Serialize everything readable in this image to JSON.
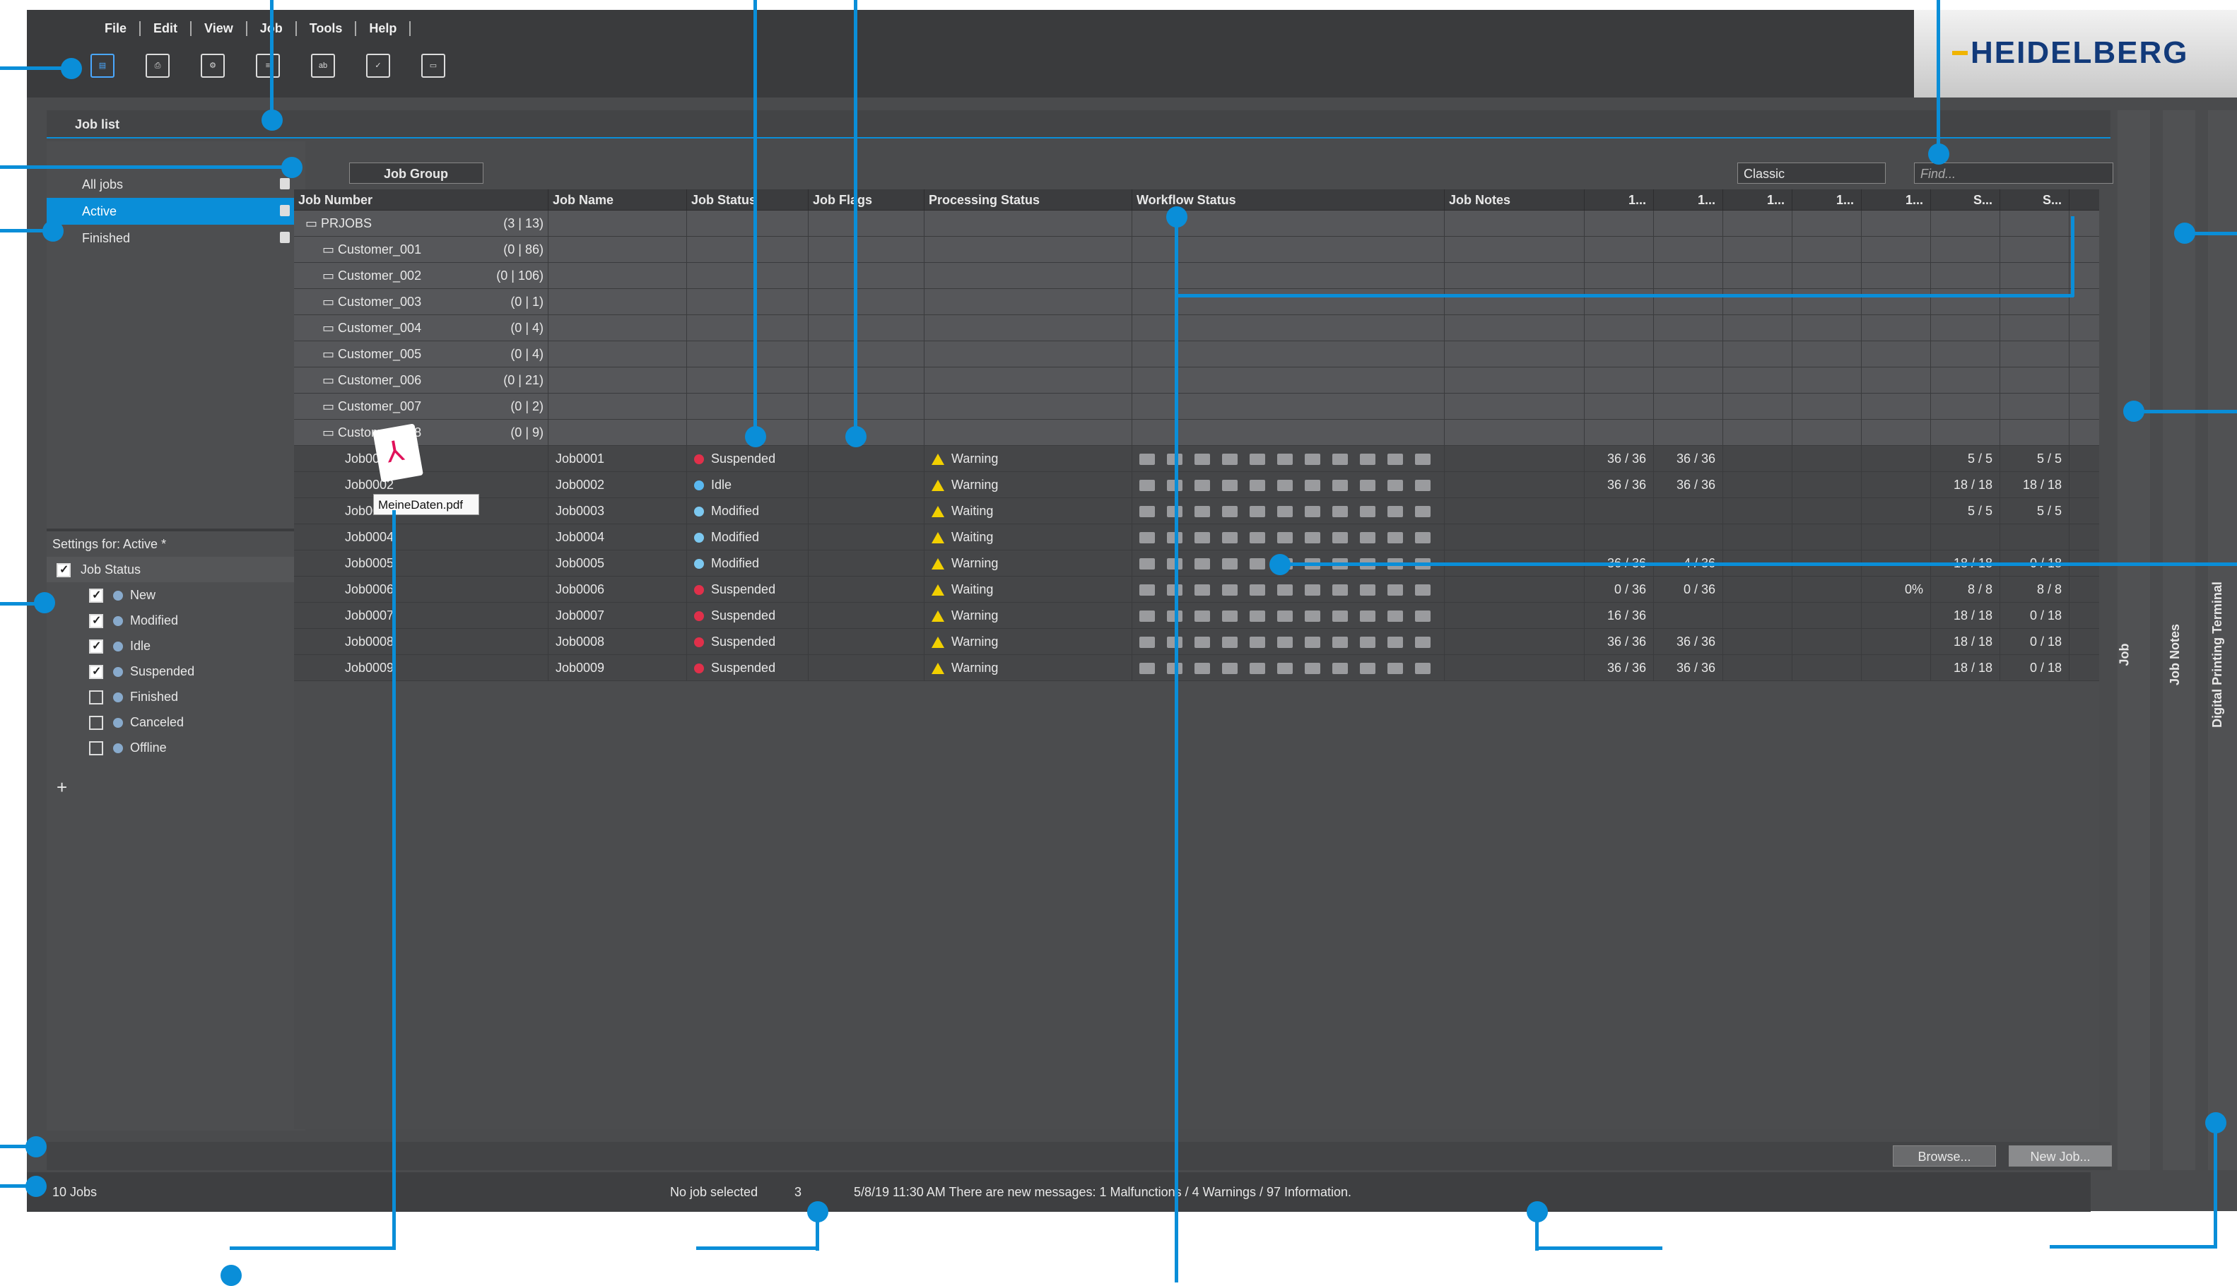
{
  "menu": [
    "File",
    "Edit",
    "View",
    "Job",
    "Tools",
    "Help"
  ],
  "logo": "HEIDELBERG",
  "joblist_title": "Job list",
  "job_group": "Job Group",
  "view_select": "Classic",
  "find_placeholder": "Find...",
  "nav": [
    {
      "label": "All jobs"
    },
    {
      "label": "Active",
      "selected": true
    },
    {
      "label": "Finished"
    }
  ],
  "settings_title": "Settings for: Active *",
  "job_status_title": "Job Status",
  "status_filters": [
    {
      "label": "New",
      "checked": true
    },
    {
      "label": "Modified",
      "checked": true
    },
    {
      "label": "Idle",
      "checked": true
    },
    {
      "label": "Suspended",
      "checked": true
    },
    {
      "label": "Finished",
      "checked": false
    },
    {
      "label": "Canceled",
      "checked": false
    },
    {
      "label": "Offline",
      "checked": false
    }
  ],
  "add": "+",
  "columns": [
    "Job Number",
    "Job Name",
    "Job Status",
    "Job Flags",
    "Processing Status",
    "Workflow Status",
    "Job Notes",
    "1...",
    "1...",
    "1...",
    "1...",
    "1...",
    "S...",
    "S..."
  ],
  "groups": [
    {
      "name": "PRJOBS",
      "count": "(3 | 13)"
    },
    {
      "name": "Customer_001",
      "count": "(0 | 86)"
    },
    {
      "name": "Customer_002",
      "count": "(0 | 106)"
    },
    {
      "name": "Customer_003",
      "count": "(0 | 1)"
    },
    {
      "name": "Customer_004",
      "count": "(0 | 4)"
    },
    {
      "name": "Customer_005",
      "count": "(0 | 4)"
    },
    {
      "name": "Customer_006",
      "count": "(0 | 21)"
    },
    {
      "name": "Customer_007",
      "count": "(0 | 2)"
    },
    {
      "name": "Customer_008",
      "count": "(0 | 9)"
    }
  ],
  "jobs": [
    {
      "num": "Job0001",
      "name": "Job0001",
      "status": "Suspended",
      "color": "#e0304a",
      "proc": "Warning",
      "a": "36 / 36",
      "b": "36 / 36",
      "c": "",
      "d": "5 / 5",
      "e": "5 / 5"
    },
    {
      "num": "Job0002",
      "name": "Job0002",
      "status": "Idle",
      "color": "#5ab8f0",
      "proc": "Warning",
      "a": "36 / 36",
      "b": "36 / 36",
      "c": "",
      "d": "18 / 18",
      "e": "18 / 18"
    },
    {
      "num": "Job0003",
      "name": "Job0003",
      "status": "Modified",
      "color": "#7cc8f0",
      "proc": "Waiting",
      "a": "",
      "b": "",
      "c": "",
      "d": "5 / 5",
      "e": "5 / 5"
    },
    {
      "num": "Job0004",
      "name": "Job0004",
      "status": "Modified",
      "color": "#7cc8f0",
      "proc": "Waiting",
      "a": "",
      "b": "",
      "c": "",
      "d": "",
      "e": ""
    },
    {
      "num": "Job0005",
      "name": "Job0005",
      "status": "Modified",
      "color": "#7cc8f0",
      "proc": "Warning",
      "a": "36 / 36",
      "b": "4 / 36",
      "c": "",
      "d": "18 / 18",
      "e": "0 / 18"
    },
    {
      "num": "Job0006",
      "name": "Job0006",
      "status": "Suspended",
      "color": "#e0304a",
      "proc": "Waiting",
      "a": "0 / 36",
      "b": "0 / 36",
      "c": "0%",
      "d": "8 / 8",
      "e": "8 / 8"
    },
    {
      "num": "Job0007",
      "name": "Job0007",
      "status": "Suspended",
      "color": "#e0304a",
      "proc": "Warning",
      "a": "16 / 36",
      "b": "",
      "c": "",
      "d": "18 / 18",
      "e": "0 / 18"
    },
    {
      "num": "Job0008",
      "name": "Job0008",
      "status": "Suspended",
      "color": "#e0304a",
      "proc": "Warning",
      "a": "36 / 36",
      "b": "36 / 36",
      "c": "",
      "d": "18 / 18",
      "e": "0 / 18"
    },
    {
      "num": "Job0009",
      "name": "Job0009",
      "status": "Suspended",
      "color": "#e0304a",
      "proc": "Warning",
      "a": "36 / 36",
      "b": "36 / 36",
      "c": "",
      "d": "18 / 18",
      "e": "0 / 18"
    }
  ],
  "tooltip": "MeineDaten.pdf",
  "buttons": {
    "browse": "Browse...",
    "new_job": "New Job..."
  },
  "statusbar": {
    "jobs": "10 Jobs",
    "selection": "No job selected",
    "msg_count": "3",
    "message": "5/8/19 11:30 AM  There are new messages: 1 Malfunctions / 4 Warnings / 97 Information."
  },
  "side_tabs": [
    "Job",
    "Job Notes",
    "Digital Printing Terminal"
  ]
}
